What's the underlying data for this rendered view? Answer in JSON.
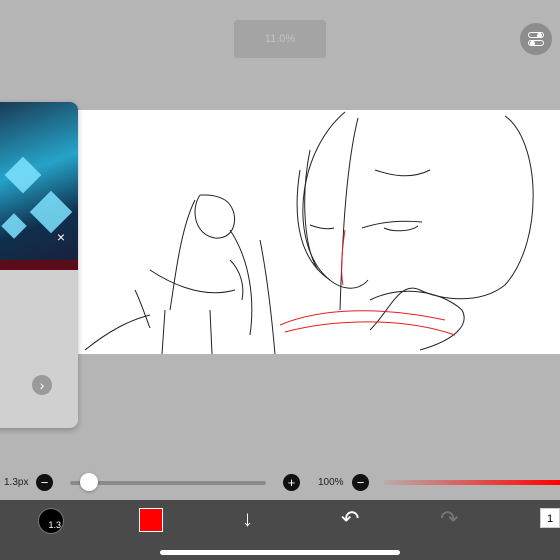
{
  "top": {
    "zoom_label": "11.0%"
  },
  "icons": {
    "settings": "toggle-settings-icon",
    "close": "close-icon",
    "next": "chevron-right-icon",
    "minus": "minus-icon",
    "plus": "plus-icon",
    "save": "arrow-down-icon",
    "undo": "undo-icon",
    "redo": "redo-icon"
  },
  "brush": {
    "size_label": "1.3px",
    "size_fraction": 0.05,
    "circle_label": "1.3"
  },
  "opacity": {
    "label": "100%",
    "value_fraction": 1.0
  },
  "color": {
    "current": "#ff0000"
  },
  "layers": {
    "count": "1"
  },
  "glyphs": {
    "minus": "−",
    "plus": "+",
    "close": "×",
    "next": "›",
    "save": "↓",
    "undo": "↶",
    "redo": "↷"
  }
}
